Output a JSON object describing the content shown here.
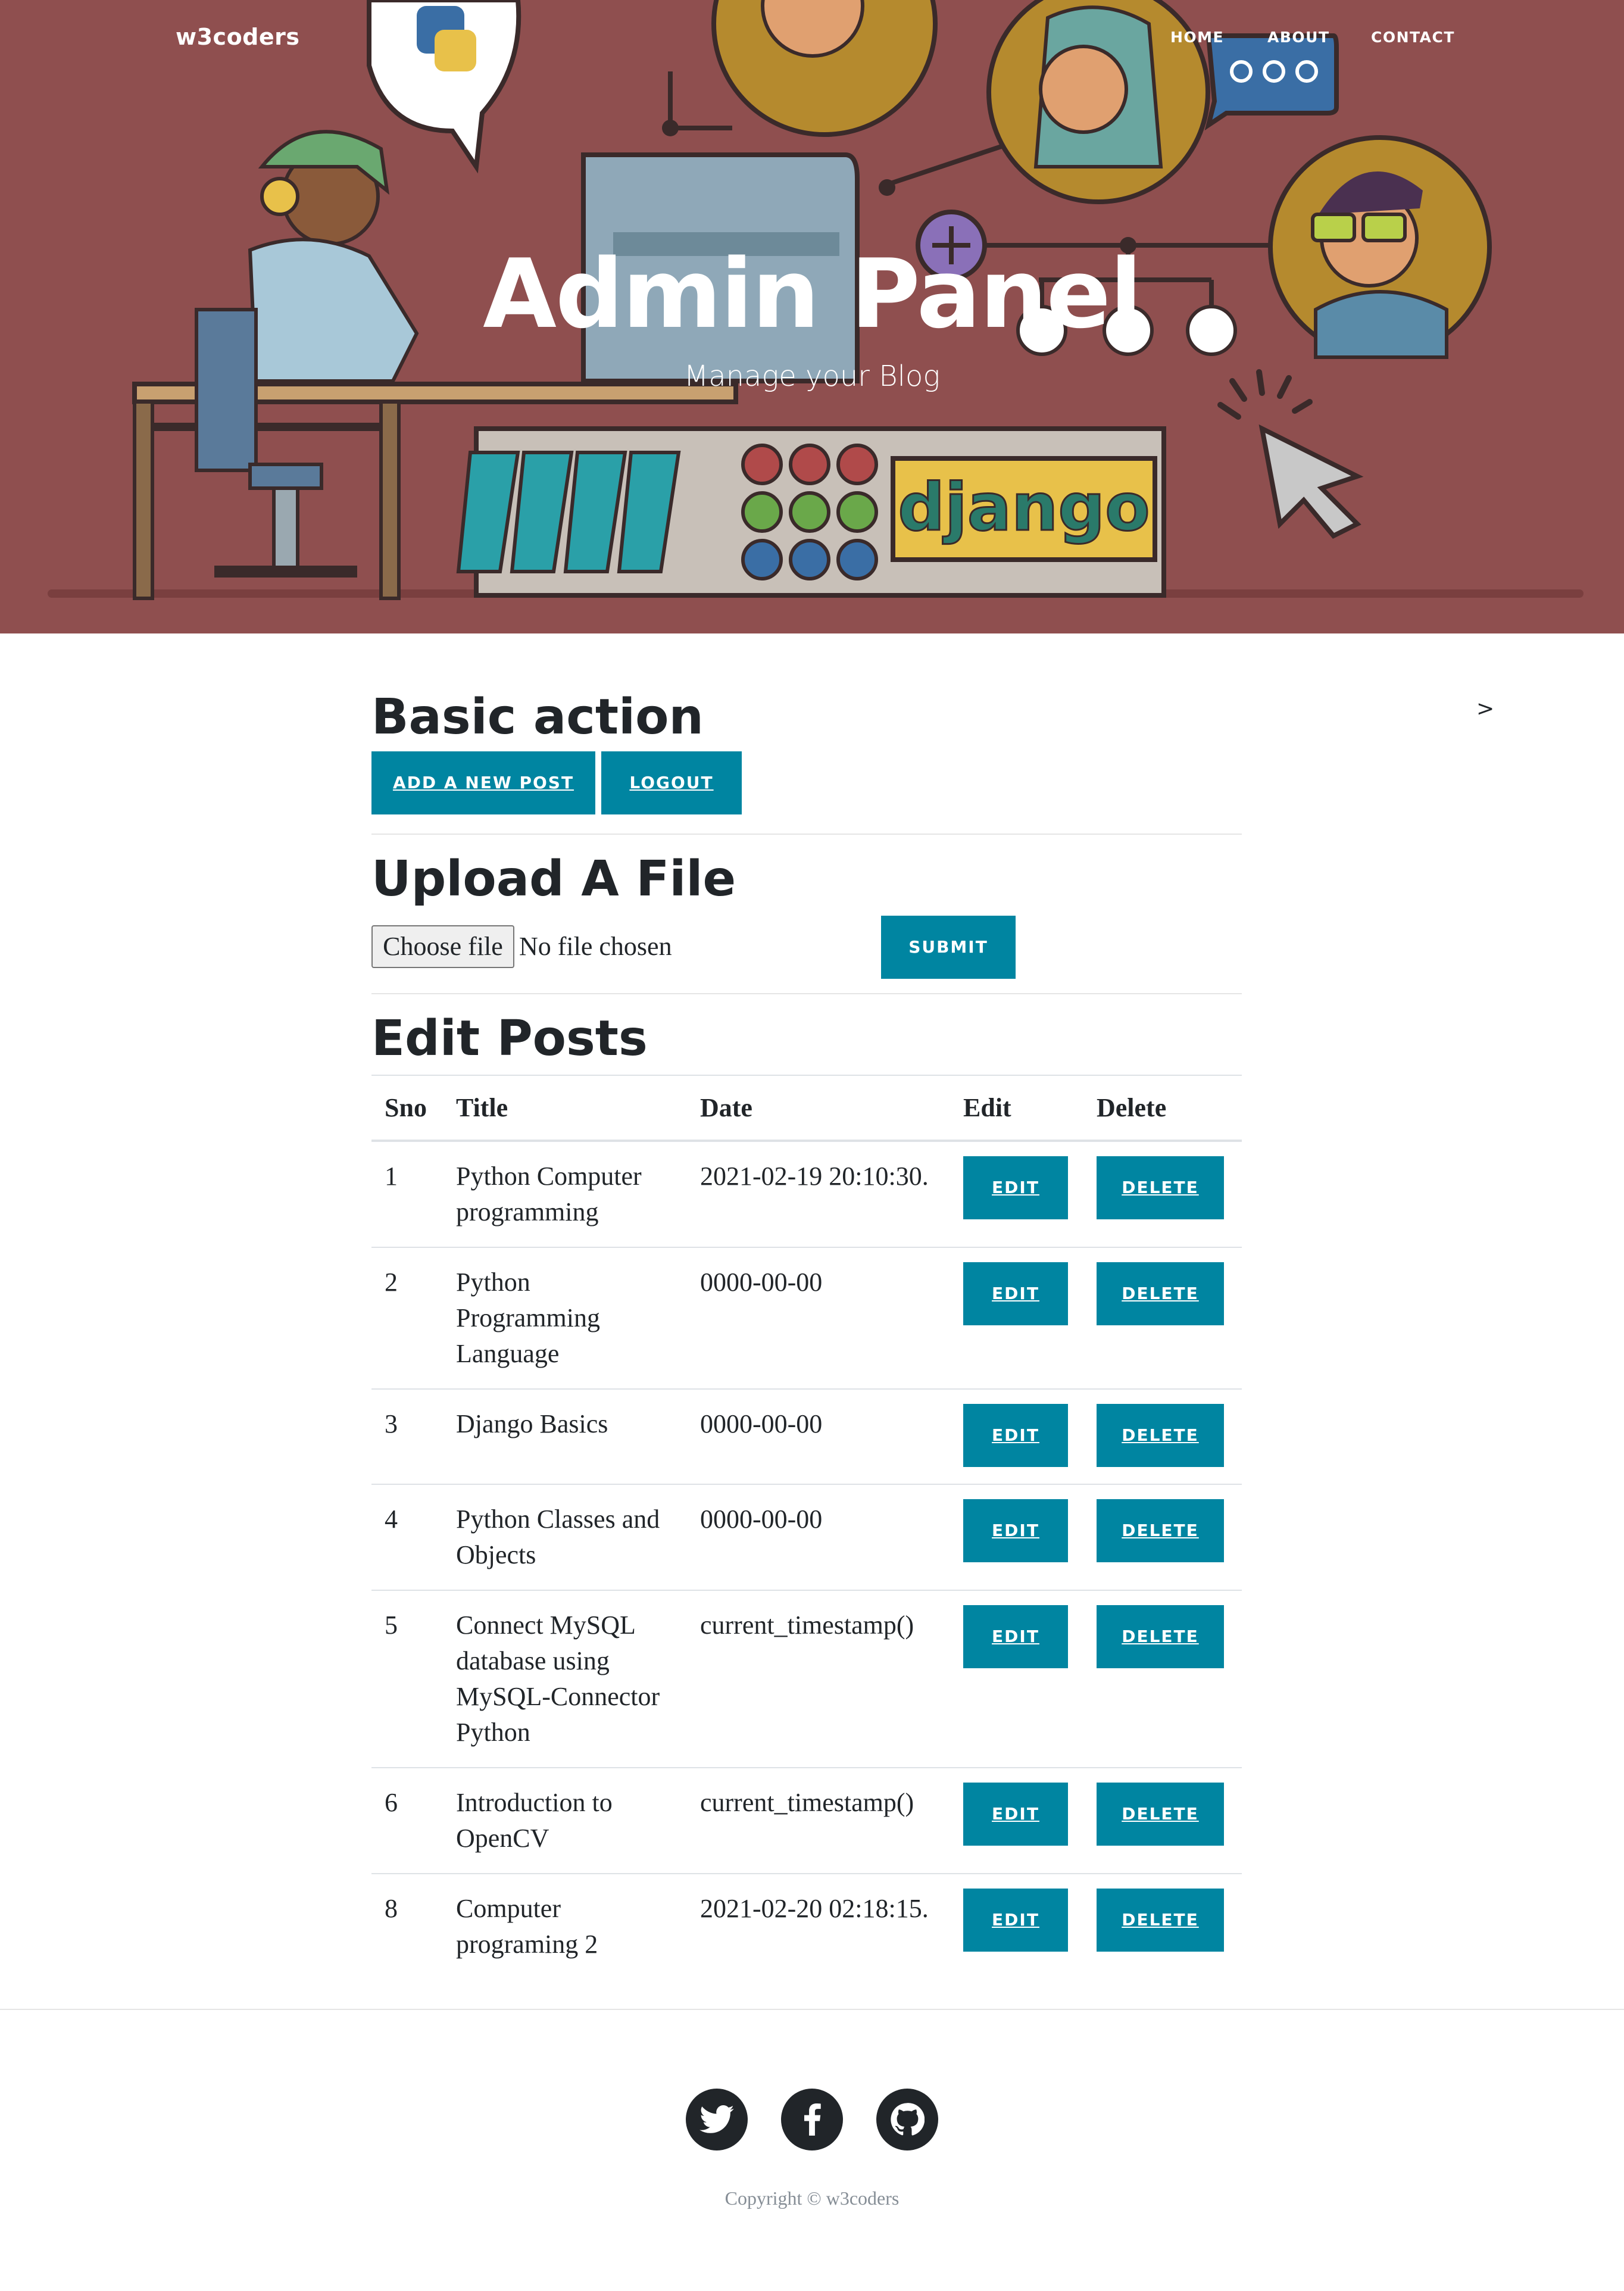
{
  "nav": {
    "brand": "w3coders",
    "links": [
      "HOME",
      "ABOUT",
      "CONTACT"
    ]
  },
  "hero": {
    "title": "Admin Panel",
    "subtitle": "Manage your Blog",
    "illustration_text": "django"
  },
  "collapse_toggle": ">",
  "basic_action": {
    "heading": "Basic action",
    "add_post_label": "ADD A NEW POST",
    "logout_label": "LOGOUT"
  },
  "upload": {
    "heading": "Upload A File",
    "choose_file_label": "Choose file",
    "file_status": "No file chosen",
    "submit_label": "SUBMIT"
  },
  "posts": {
    "heading": "Edit Posts",
    "columns": [
      "Sno",
      "Title",
      "Date",
      "Edit",
      "Delete"
    ],
    "edit_label": "EDIT",
    "delete_label": "DELETE",
    "rows": [
      {
        "sno": "1",
        "title": "Python Computer programming",
        "date": "2021-02-19 20:10:30."
      },
      {
        "sno": "2",
        "title": "Python Programming Language",
        "date": "0000-00-00"
      },
      {
        "sno": "3",
        "title": "Django Basics",
        "date": "0000-00-00"
      },
      {
        "sno": "4",
        "title": "Python Classes and Objects",
        "date": "0000-00-00"
      },
      {
        "sno": "5",
        "title": "Connect MySQL database using MySQL-Connector Python",
        "date": "current_timestamp()"
      },
      {
        "sno": "6",
        "title": "Introduction to OpenCV",
        "date": "current_timestamp()"
      },
      {
        "sno": "8",
        "title": "Computer programing 2",
        "date": "2021-02-20 02:18:15."
      }
    ]
  },
  "footer": {
    "social_icons": [
      "twitter-icon",
      "facebook-icon",
      "github-icon"
    ],
    "copyright": "Copyright © w3coders"
  },
  "colors": {
    "hero_bg": "#8f4f4f",
    "primary": "#0085a1",
    "text": "#212529",
    "muted": "#868e96"
  }
}
